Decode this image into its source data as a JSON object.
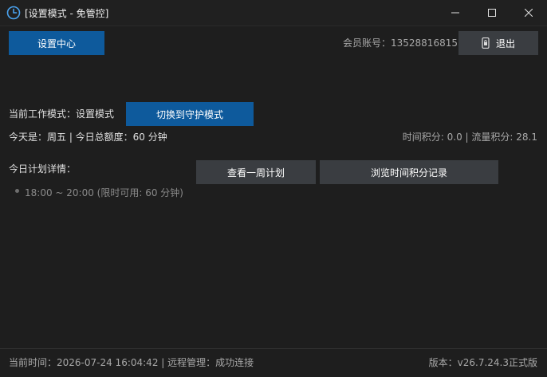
{
  "window": {
    "title": "[设置模式 - 免管控]"
  },
  "icons": {
    "app": "clock-icon",
    "minimize": "minimize-icon",
    "maximize": "maximize-icon",
    "close": "close-icon",
    "logout": "phone-lock-icon"
  },
  "header": {
    "settings_center_label": "设置中心",
    "account": "会员账号：13528816815",
    "logout_label": "退出"
  },
  "mode": {
    "current_label": "当前工作模式：设置模式",
    "switch_button_label": "切换到守护模式"
  },
  "today": {
    "summary": "今天是：周五 | 今日总额度：60 分钟",
    "points": "时间积分: 0.0 | 流量积分: 28.1"
  },
  "plan": {
    "details_label": "今日计划详情：",
    "week_button_label": "查看一周计划",
    "history_button_label": "浏览时间积分记录",
    "items": [
      "18:00 ~ 20:00 (限时可用: 60 分钟)"
    ]
  },
  "footer": {
    "status": "当前时间：2026-07-24 16:04:42  |  远程管理：成功连接",
    "version": "版本：v26.7.24.3正式版"
  },
  "colors": {
    "background": "#1e1e1e",
    "primary_button": "#0e5a9c",
    "secondary_button": "#3a3d41",
    "muted_text": "#a8a8a8"
  }
}
